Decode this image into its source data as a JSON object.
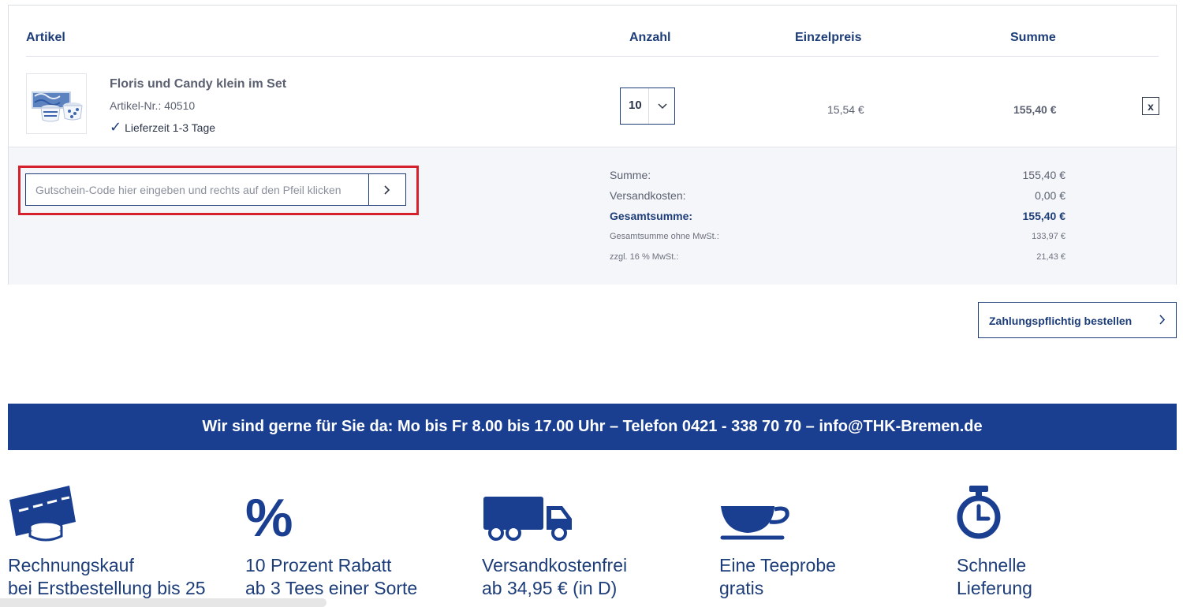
{
  "cart": {
    "columns": {
      "article": "Artikel",
      "quantity": "Anzahl",
      "unit_price": "Einzelpreis",
      "sum": "Summe"
    },
    "item": {
      "name": "Floris und Candy klein im Set",
      "article_no": "Artikel-Nr.: 40510",
      "delivery": "Lieferzeit 1-3 Tage",
      "quantity": "10",
      "unit_price": "15,54 €",
      "line_sum": "155,40 €",
      "remove_label": "x"
    },
    "coupon": {
      "placeholder": "Gutschein-Code hier eingeben und rechts auf den Pfeil klicken"
    },
    "totals": {
      "subtotal_label": "Summe:",
      "subtotal_value": "155,40 €",
      "shipping_label": "Versandkosten:",
      "shipping_value": "0,00 €",
      "grand_label": "Gesamtsumme:",
      "grand_value": "155,40 €",
      "net_label": "Gesamtsumme ohne MwSt.:",
      "net_value": "133,97 €",
      "vat_label": "zzgl. 16 % MwSt.:",
      "vat_value": "21,43 €"
    }
  },
  "order_button": {
    "label": "Zahlungspflichtig bestellen"
  },
  "contact_bar": {
    "text": "Wir sind gerne für Sie da: Mo bis Fr 8.00 bis 17.00 Uhr – Telefon 0421 - 338 70 70 – info@THK-Bremen.de"
  },
  "features": [
    {
      "icon": "invoice-coins-icon",
      "line1": "Rechnungskauf",
      "line2": "bei Erstbestellung bis 25"
    },
    {
      "icon": "percent-icon",
      "line1": "10 Prozent Rabatt",
      "line2": "ab 3 Tees einer Sorte"
    },
    {
      "icon": "truck-icon",
      "line1": "Versandkostenfrei",
      "line2": "ab 34,95 € (in D)"
    },
    {
      "icon": "teacup-icon",
      "line1": "Eine Teeprobe",
      "line2": "gratis"
    },
    {
      "icon": "stopwatch-icon",
      "line1": "Schnelle",
      "line2": "Lieferung"
    }
  ],
  "colors": {
    "brand_blue": "#1a3f91",
    "text_blue": "#1d3d78",
    "highlight_red": "#d4212b",
    "panel_bg": "#f5f6fa"
  }
}
